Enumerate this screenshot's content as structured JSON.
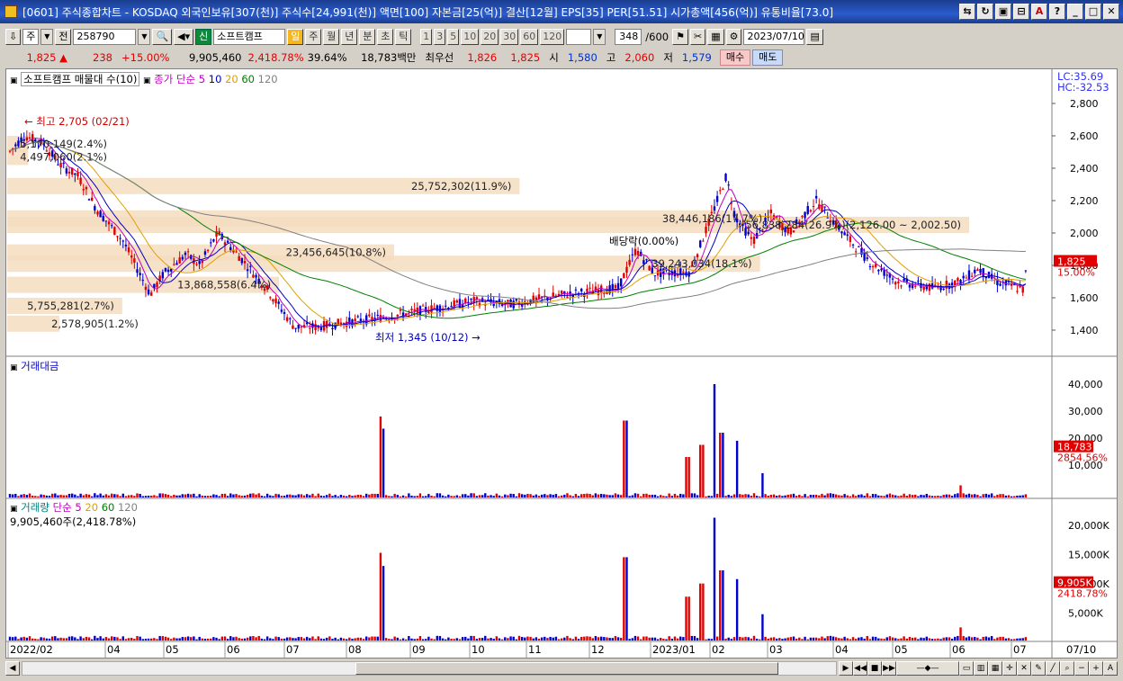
{
  "window": {
    "title": "[0601] 주식종합차트 - KOSDAQ 외국인보유[307(천)] 주식수[24,991(천)] 액면[100] 자본금[25(억)] 결산[12월] EPS[35] PER[51.51] 시가총액[456(억)] 유통비율[73.0]"
  },
  "toolbar": {
    "period_unit": "주",
    "market": "전",
    "code": "258790",
    "credit_tag": "신",
    "stock_name": "소프트캠프",
    "periods": [
      "일",
      "주",
      "월",
      "년",
      "분",
      "초",
      "틱"
    ],
    "active_period": "일",
    "intervals": [
      "1",
      "3",
      "5",
      "10",
      "20",
      "30",
      "60",
      "120"
    ],
    "count_display": "348",
    "count_total": "/600",
    "date": "2023/07/10"
  },
  "quote": {
    "price": "1,825",
    "change": "238",
    "change_pct": "+15.00%",
    "volume": "9,905,460",
    "volume_ratio": "2,418.78%",
    "turnover": "39.64%",
    "amount": "18,783백만",
    "priority_label": "최우선",
    "ask": "1,826",
    "bid": "1,825",
    "open_label": "시",
    "open": "1,580",
    "high_label": "고",
    "high": "2,060",
    "low_label": "저",
    "low": "1,579",
    "buy_label": "매수",
    "sell_label": "매도"
  },
  "price_pane": {
    "header_title": "소프트캠프 매물대 수(10)",
    "ma_label": "종가 단순",
    "ma_periods": [
      "5",
      "10",
      "20",
      "60",
      "120"
    ],
    "ma_colors": [
      "#c000c0",
      "#0000c0",
      "#e0a000",
      "#008000",
      "#808080"
    ],
    "lc": "LC:35.69",
    "hc": "HC:-32.53",
    "y_ticks": [
      "2,800",
      "2,600",
      "2,400",
      "2,200",
      "2,000",
      "1,800",
      "1,600",
      "1,400"
    ],
    "current_price_tag": "1,825",
    "current_pct_tag": "15.00%",
    "high_annotation": "최고 2,705 (02/21)",
    "low_annotation": "최저 1,345 (10/12)",
    "dividend_annotation": "배당락(0.00%)",
    "volume_profile": [
      {
        "label": "5,170,149(2.4%)",
        "price": 2550,
        "frac": 0.02
      },
      {
        "label": "4,497,060(2.1%)",
        "price": 2470,
        "frac": 0.02
      },
      {
        "label": "25,752,302(11.9%)",
        "price": 2290,
        "frac": 0.49
      },
      {
        "label": "38,446,186(17.7%)",
        "price": 2090,
        "frac": 0.73
      },
      {
        "label": "56,838,284(26.9%)(2,126.00 ~ 2,002.50)",
        "price": 2050,
        "frac": 0.92
      },
      {
        "label": "23,456,645(10.8%)",
        "price": 1880,
        "frac": 0.37
      },
      {
        "label": "39,243,034(18.1%)",
        "price": 1810,
        "frac": 0.72
      },
      {
        "label": "13,868,558(6.4%)",
        "price": 1680,
        "frac": 0.26
      },
      {
        "label": "5,755,281(2.7%)",
        "price": 1550,
        "frac": 0.11
      },
      {
        "label": "2,578,905(1.2%)",
        "price": 1440,
        "frac": 0.05
      }
    ]
  },
  "amount_pane": {
    "title": "거래대금",
    "y_ticks": [
      "40,000",
      "30,000",
      "20,000",
      "10,000"
    ],
    "current_tag": "18,783",
    "current_pct_tag": "2854.56%"
  },
  "volume_pane": {
    "title": "거래량",
    "ma_label": "단순",
    "ma_periods": [
      "5",
      "20",
      "60",
      "120"
    ],
    "current_text": "9,905,460주(2,418.78%)",
    "y_ticks": [
      "20,000K",
      "15,000K",
      "10,000K",
      "5,000K"
    ],
    "current_tag": "9,905K",
    "current_pct_tag": "2418.78%"
  },
  "x_axis": {
    "labels": [
      "2022/02",
      "04",
      "05",
      "06",
      "07",
      "08",
      "09",
      "10",
      "11",
      "12",
      "2023/01",
      "02",
      "03",
      "04",
      "05",
      "06",
      "07"
    ],
    "end_label": "07/10"
  },
  "colors": {
    "up": "#e00000",
    "down": "#0000d0",
    "title_bar": "#1a3d8f",
    "profile": "#f5dcc0"
  }
}
